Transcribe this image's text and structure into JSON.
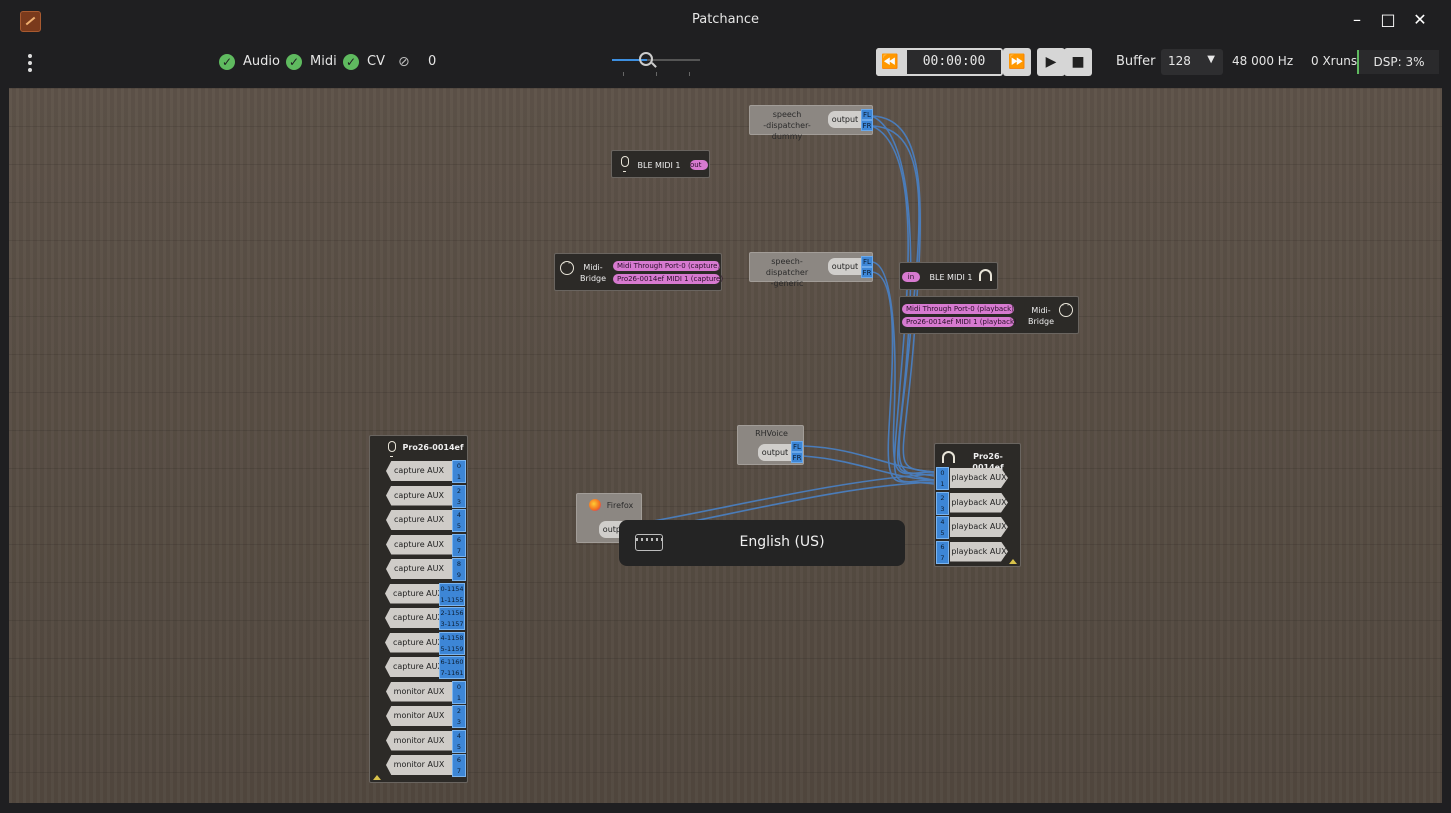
{
  "window": {
    "title": "Patchance"
  },
  "toolbar": {
    "audio_label": "Audio",
    "midi_label": "Midi",
    "cv_label": "CV",
    "hidden_count": "0",
    "time": "00:00:00",
    "buffer_label": "Buffer :",
    "buffer_value": "128",
    "sample_rate": "48 000 Hz",
    "xruns": "0 Xruns",
    "dsp": "DSP: 3%",
    "zoom_fraction": 0.4
  },
  "boxes": {
    "dispatcher_dummy": {
      "name1": "speech",
      "name2": "-dispatcher-dummy",
      "port": "output",
      "ch1": "FL",
      "ch2": "FR"
    },
    "ble_out": {
      "name": "BLE MIDI 1",
      "port": "out"
    },
    "midi_bridge_out": {
      "name1": "Midi-",
      "name2": "Bridge",
      "port1": "Midi Through Port-0 (capture)",
      "port2": "Pro26-0014ef MIDI 1 (capture)"
    },
    "dispatcher_generic": {
      "name1": "speech-dispatcher",
      "name2": "-generic",
      "port": "output",
      "ch1": "FL",
      "ch2": "FR"
    },
    "ble_in": {
      "name": "BLE MIDI 1",
      "port": "in"
    },
    "midi_bridge_in": {
      "name1": "Midi-",
      "name2": "Bridge",
      "port1": "Midi Through Port-0 (playback)",
      "port2": "Pro26-0014ef MIDI 1 (playback)"
    },
    "rhvoice": {
      "name": "RHVoice",
      "port": "output",
      "ch1": "FL",
      "ch2": "FR"
    },
    "firefox": {
      "name": "Firefox",
      "port": "output"
    },
    "pro26_capture": {
      "name": "Pro26-0014ef",
      "ports": [
        {
          "label": "capture AUX",
          "c1": "0",
          "c2": "1"
        },
        {
          "label": "capture AUX",
          "c1": "2",
          "c2": "3"
        },
        {
          "label": "capture AUX",
          "c1": "4",
          "c2": "5"
        },
        {
          "label": "capture AUX",
          "c1": "6",
          "c2": "7"
        },
        {
          "label": "capture AUX",
          "c1": "8",
          "c2": "9"
        },
        {
          "label": "capture AUX",
          "c1": "0-1154",
          "c2": "1-1155"
        },
        {
          "label": "capture AUX",
          "c1": "2-1156",
          "c2": "3-1157"
        },
        {
          "label": "capture AUX",
          "c1": "4-1158",
          "c2": "5-1159"
        },
        {
          "label": "capture AUX",
          "c1": "6-1160",
          "c2": "7-1161"
        },
        {
          "label": "monitor AUX",
          "c1": "0",
          "c2": "1"
        },
        {
          "label": "monitor AUX",
          "c1": "2",
          "c2": "3"
        },
        {
          "label": "monitor AUX",
          "c1": "4",
          "c2": "5"
        },
        {
          "label": "monitor AUX",
          "c1": "6",
          "c2": "7"
        }
      ]
    },
    "pro26_playback": {
      "name": "Pro26-0014ef",
      "ports": [
        {
          "label": "playback AUX",
          "c1": "0",
          "c2": "1"
        },
        {
          "label": "playback AUX",
          "c1": "2",
          "c2": "3"
        },
        {
          "label": "playback AUX",
          "c1": "4",
          "c2": "5"
        },
        {
          "label": "playback AUX",
          "c1": "6",
          "c2": "7"
        }
      ]
    }
  },
  "osd": {
    "text": "English (US)"
  },
  "colors": {
    "audio_port": "#3d86d6",
    "midi_port": "#d77ad0",
    "connection": "#4a7fc0",
    "ok": "#5fba5f"
  }
}
